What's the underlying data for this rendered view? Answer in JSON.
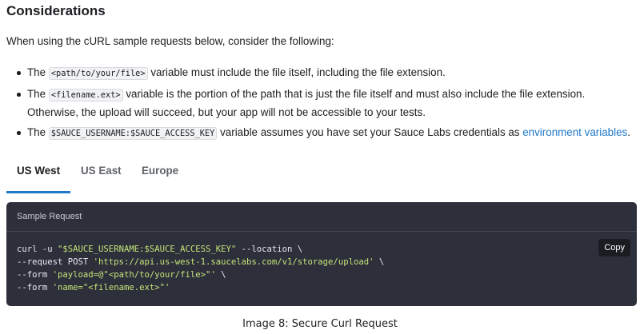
{
  "heading": "Considerations",
  "intro": "When using the cURL sample requests below, consider the following:",
  "bullets": [
    {
      "pre": "The ",
      "code": "<path/to/your/file>",
      "post": " variable must include the file itself, including the file extension."
    },
    {
      "pre": "The ",
      "code": "<filename.ext>",
      "post": " variable is the portion of the path that is just the file itself and must also include the file extension. Otherwise, the upload will succeed, but your app will not be accessible to your tests."
    },
    {
      "pre": "The ",
      "code": "$SAUCE_USERNAME:$SAUCE_ACCESS_KEY",
      "post": " variable assumes you have set your Sauce Labs credentials as ",
      "link": "environment variables",
      "end": "."
    }
  ],
  "tabs": [
    {
      "label": "US West",
      "active": true
    },
    {
      "label": "US East",
      "active": false
    },
    {
      "label": "Europe",
      "active": false
    }
  ],
  "code_block": {
    "title": "Sample Request",
    "copy_label": "Copy",
    "lines": [
      {
        "a": "curl -u ",
        "s": "\"$SAUCE_USERNAME:$SAUCE_ACCESS_KEY\"",
        "b": " --location \\"
      },
      {
        "a": "--request POST ",
        "s": "'https://api.us-west-1.saucelabs.com/v1/storage/upload'",
        "b": " \\"
      },
      {
        "a": "--form ",
        "s": "'payload=@\"<path/to/your/file>\"'",
        "b": " \\"
      },
      {
        "a": "--form ",
        "s": "'name=\"<filename.ext>\"'",
        "b": ""
      }
    ]
  },
  "caption": "Image 8: Secure Curl Request",
  "colors": {
    "link": "#1f78c8",
    "code_bg": "#2d2f3b",
    "code_string": "#c5e478",
    "active_tab_underline": "#1f78c8"
  }
}
